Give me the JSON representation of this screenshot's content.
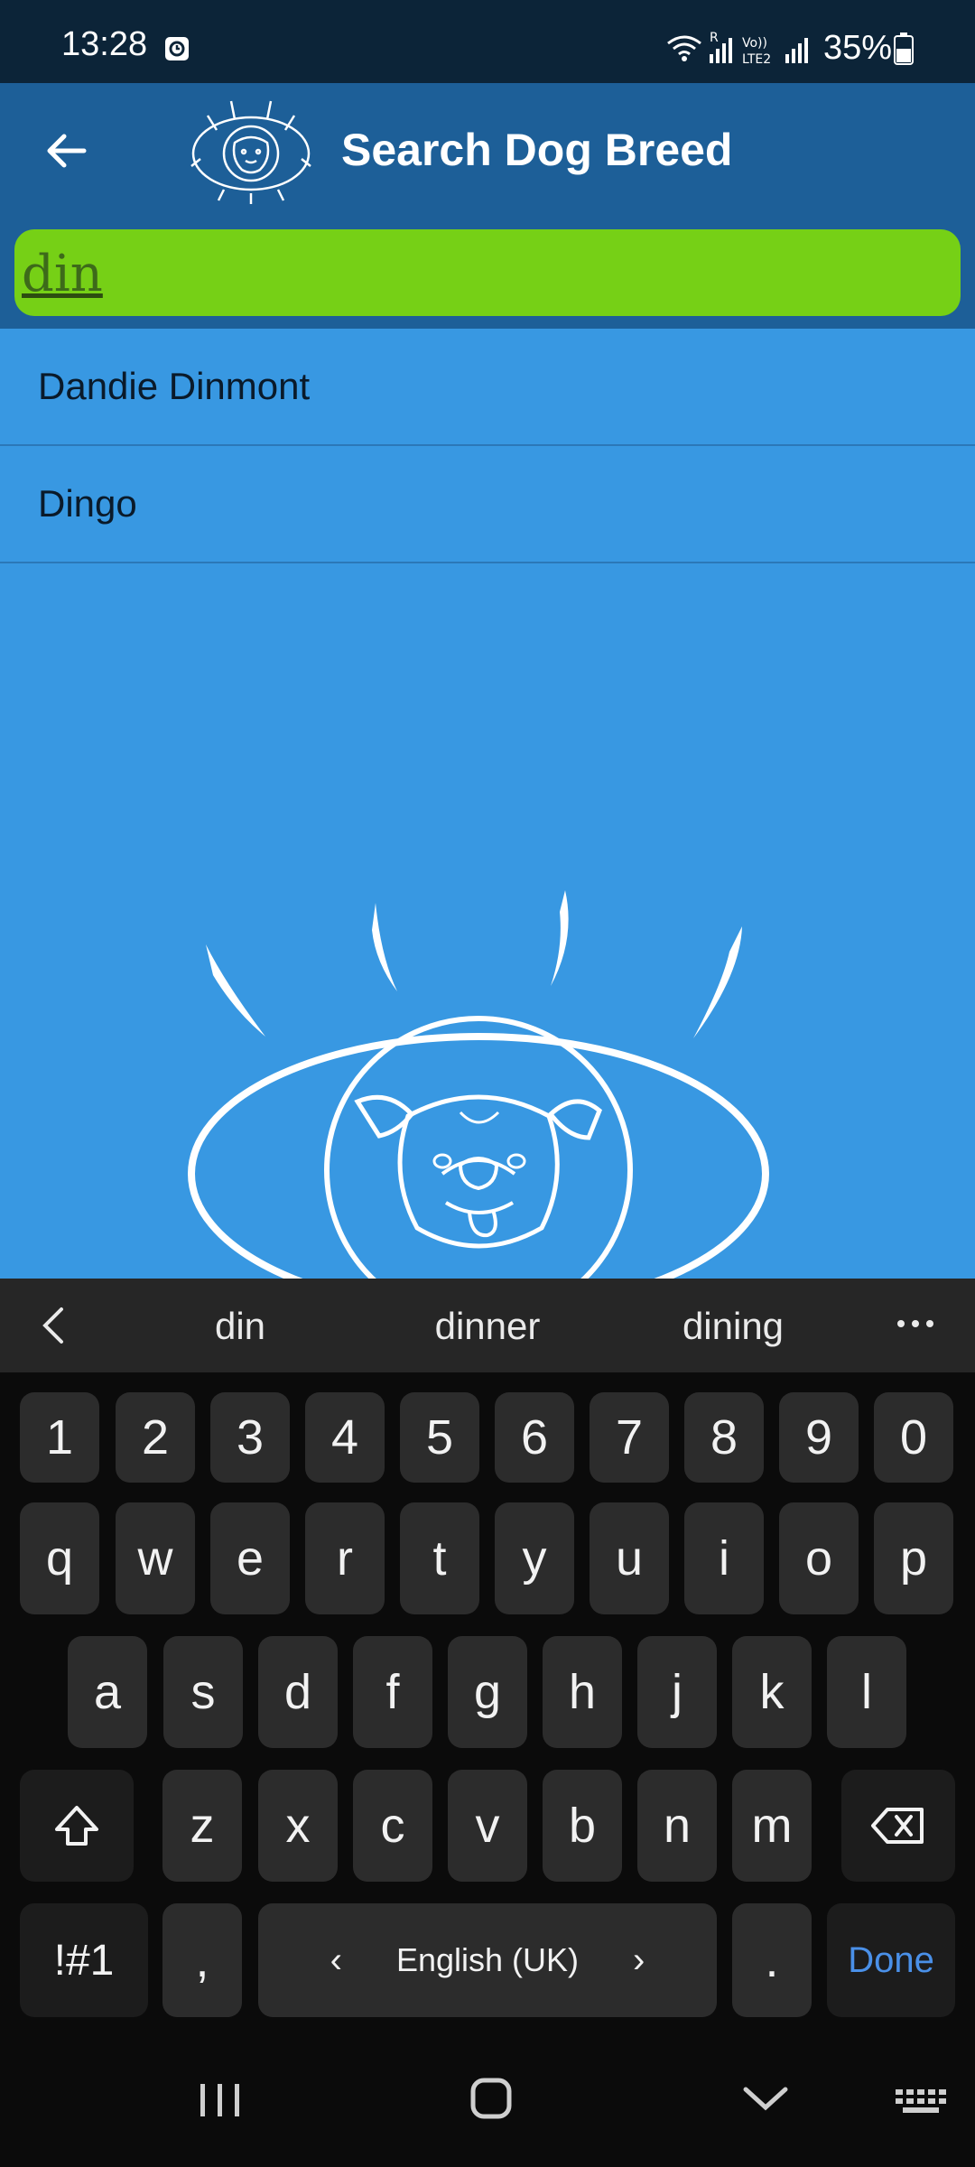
{
  "status_bar": {
    "time": "13:28",
    "battery_text": "35%",
    "icons": [
      "alarm-icon",
      "wifi-icon",
      "signal-roaming-icon",
      "volte-icon",
      "signal-icon",
      "battery-icon"
    ]
  },
  "app_bar": {
    "title": "Search Dog Breed"
  },
  "search": {
    "value": "din"
  },
  "results": [
    {
      "label": "Dandie Dinmont"
    },
    {
      "label": "Dingo"
    }
  ],
  "suggestions": [
    "din",
    "dinner",
    "dining"
  ],
  "keyboard": {
    "number_row": [
      "1",
      "2",
      "3",
      "4",
      "5",
      "6",
      "7",
      "8",
      "9",
      "0"
    ],
    "row1": [
      "q",
      "w",
      "e",
      "r",
      "t",
      "y",
      "u",
      "i",
      "o",
      "p"
    ],
    "row2": [
      "a",
      "s",
      "d",
      "f",
      "g",
      "h",
      "j",
      "k",
      "l"
    ],
    "row3": [
      "z",
      "x",
      "c",
      "v",
      "b",
      "n",
      "m"
    ],
    "symbols_label": "!#1",
    "comma_label": ",",
    "space_label": "English (UK)",
    "period_label": ".",
    "done_label": "Done"
  },
  "colors": {
    "status_bg": "#0c2438",
    "appbar_bg": "#1d5f98",
    "content_bg": "#3898e2",
    "search_bg": "#76d016",
    "keyboard_bg": "#0b0b0b",
    "key_bg": "#2c2c2c",
    "done_accent": "#4a90e8"
  }
}
